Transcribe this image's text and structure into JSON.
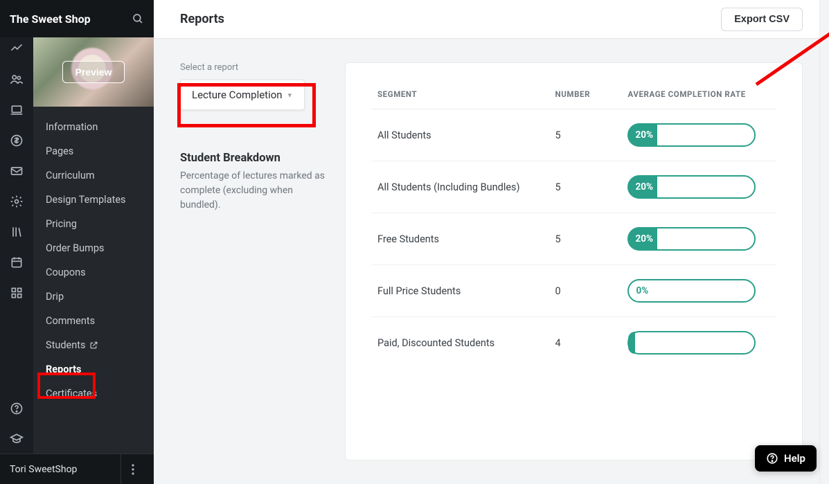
{
  "brand": {
    "title": "The Sweet Shop"
  },
  "hero": {
    "preview_label": "Preview"
  },
  "nav": {
    "items": [
      {
        "label": "Information"
      },
      {
        "label": "Pages"
      },
      {
        "label": "Curriculum"
      },
      {
        "label": "Design Templates"
      },
      {
        "label": "Pricing"
      },
      {
        "label": "Order Bumps"
      },
      {
        "label": "Coupons"
      },
      {
        "label": "Drip"
      },
      {
        "label": "Comments"
      },
      {
        "label": "Students",
        "external": true
      },
      {
        "label": "Reports",
        "active": true
      },
      {
        "label": "Certificates"
      }
    ]
  },
  "user": {
    "name": "Tori SweetShop"
  },
  "page": {
    "title": "Reports",
    "export_label": "Export CSV",
    "select_label": "Select a report",
    "selected_report": "Lecture Completion",
    "breakdown_title": "Student Breakdown",
    "breakdown_desc": "Percentage of lectures marked as complete (excluding when bundled)."
  },
  "table": {
    "headers": {
      "segment": "SEGMENT",
      "number": "NUMBER",
      "rate": "AVERAGE COMPLETION RATE"
    },
    "rows": [
      {
        "segment": "All Students",
        "number": "5",
        "rate_pct": 20,
        "rate_label": "20%"
      },
      {
        "segment": "All Students (Including Bundles)",
        "number": "5",
        "rate_pct": 20,
        "rate_label": "20%"
      },
      {
        "segment": "Free Students",
        "number": "5",
        "rate_pct": 20,
        "rate_label": "20%"
      },
      {
        "segment": "Full Price Students",
        "number": "0",
        "rate_pct": 0,
        "rate_label": "0%"
      },
      {
        "segment": "Paid, Discounted Students",
        "number": "4",
        "rate_pct": 1,
        "rate_label": ""
      }
    ]
  },
  "help": {
    "label": "Help"
  },
  "colors": {
    "accent": "#2aa08a",
    "annotation": "#f30000"
  }
}
